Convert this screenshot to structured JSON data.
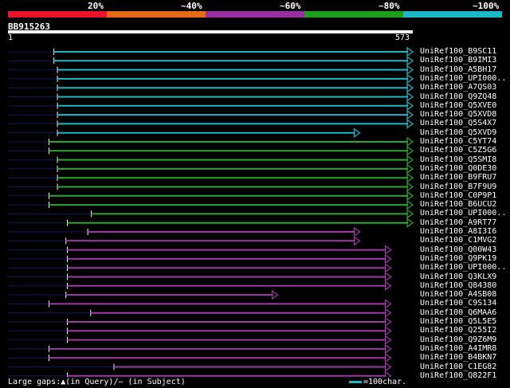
{
  "query": {
    "id": "BB915263",
    "start": "1",
    "end": "573"
  },
  "legend": {
    "segments": [
      {
        "color": "#e8142b",
        "label": "20%"
      },
      {
        "color": "#e86a14",
        "label": "~40%"
      },
      {
        "color": "#9a2fa0",
        "label": "~60%"
      },
      {
        "color": "#1ba01b",
        "label": "~80%"
      },
      {
        "color": "#1bb8c8",
        "label": "~100%"
      }
    ]
  },
  "colors": {
    "cyan": "#1bb8c8",
    "green": "#2aa82a",
    "magenta": "#a038a8",
    "navy": "#101a55",
    "marker": "#ffffa0"
  },
  "query_length": 573,
  "hits": [
    {
      "label": "UniRef100_B9SC11",
      "color": "cyan",
      "start": 65,
      "end": 573
    },
    {
      "label": "UniRef100_B9IMI3",
      "color": "cyan",
      "start": 65,
      "end": 573
    },
    {
      "label": "UniRef100_A5BH17",
      "color": "cyan",
      "start": 70,
      "end": 573
    },
    {
      "label": "UniRef100_UPI000..",
      "color": "cyan",
      "start": 70,
      "end": 573
    },
    {
      "label": "UniRef100_A7QS03",
      "color": "cyan",
      "start": 70,
      "end": 573
    },
    {
      "label": "UniRef100_Q9ZQ48",
      "color": "cyan",
      "start": 70,
      "end": 573
    },
    {
      "label": "UniRef100_Q5XVE0",
      "color": "cyan",
      "start": 70,
      "end": 573
    },
    {
      "label": "UniRef100_Q5XVD8",
      "color": "cyan",
      "start": 70,
      "end": 573
    },
    {
      "label": "UniRef100_Q5S4X7",
      "color": "cyan",
      "start": 70,
      "end": 573
    },
    {
      "label": "UniRef100_Q5XVD9",
      "color": "cyan",
      "start": 70,
      "end": 498
    },
    {
      "label": "UniRef100_C5YT74",
      "color": "green",
      "start": 58,
      "end": 573
    },
    {
      "label": "UniRef100_C5Z5G6",
      "color": "green",
      "start": 58,
      "end": 573
    },
    {
      "label": "UniRef100_Q5SMI8",
      "color": "green",
      "start": 70,
      "end": 573
    },
    {
      "label": "UniRef100_Q0DE30",
      "color": "green",
      "start": 70,
      "end": 573
    },
    {
      "label": "UniRef100_B9FRU7",
      "color": "green",
      "start": 70,
      "end": 573
    },
    {
      "label": "UniRef100_B7F9U9",
      "color": "green",
      "start": 70,
      "end": 573
    },
    {
      "label": "UniRef100_C0P9P1",
      "color": "green",
      "start": 58,
      "end": 573
    },
    {
      "label": "UniRef100_B6UCU2",
      "color": "green",
      "start": 58,
      "end": 573
    },
    {
      "label": "UniRef100_UPI000..",
      "color": "green",
      "start": 118,
      "end": 573
    },
    {
      "label": "UniRef100_A9RT77",
      "color": "green",
      "start": 84,
      "end": 573
    },
    {
      "label": "UniRef100_A8I3I6",
      "color": "magenta",
      "start": 113,
      "end": 498
    },
    {
      "label": "UniRef100_C1MVG2",
      "color": "magenta",
      "start": 82,
      "end": 498
    },
    {
      "label": "UniRef100_Q00W43",
      "color": "magenta",
      "start": 84,
      "end": 542
    },
    {
      "label": "UniRef100_Q9PK19",
      "color": "magenta",
      "start": 84,
      "end": 542
    },
    {
      "label": "UniRef100_UPI000..",
      "color": "magenta",
      "start": 84,
      "end": 542
    },
    {
      "label": "UniRef100_Q3KLX9",
      "color": "magenta",
      "start": 84,
      "end": 542
    },
    {
      "label": "UniRef100_Q84380",
      "color": "magenta",
      "start": 84,
      "end": 542
    },
    {
      "label": "UniRef100_A4SB08",
      "color": "magenta",
      "start": 82,
      "end": 382
    },
    {
      "label": "UniRef100_C9S134",
      "color": "magenta",
      "start": 58,
      "end": 542
    },
    {
      "label": "UniRef100_Q6MAA6",
      "color": "magenta",
      "start": 117,
      "end": 542
    },
    {
      "label": "UniRef100_Q5L5E5",
      "color": "magenta",
      "start": 84,
      "end": 542
    },
    {
      "label": "UniRef100_Q255I2",
      "color": "magenta",
      "start": 84,
      "end": 542
    },
    {
      "label": "UniRef100_Q9Z6M9",
      "color": "magenta",
      "start": 84,
      "end": 542
    },
    {
      "label": "UniRef100_A4IMR8",
      "color": "magenta",
      "start": 58,
      "end": 542
    },
    {
      "label": "UniRef100_B4BKN7",
      "color": "magenta",
      "start": 58,
      "end": 542
    },
    {
      "label": "UniRef100_C1EG82",
      "color": "magenta",
      "start": 150,
      "end": 542
    },
    {
      "label": "UniRef100_Q822F1",
      "color": "magenta",
      "start": 84,
      "end": 542
    }
  ],
  "footer": {
    "gaps_text": "Large gaps:▲(in Query)/– (in Subject)",
    "scale_text": "=100char."
  }
}
